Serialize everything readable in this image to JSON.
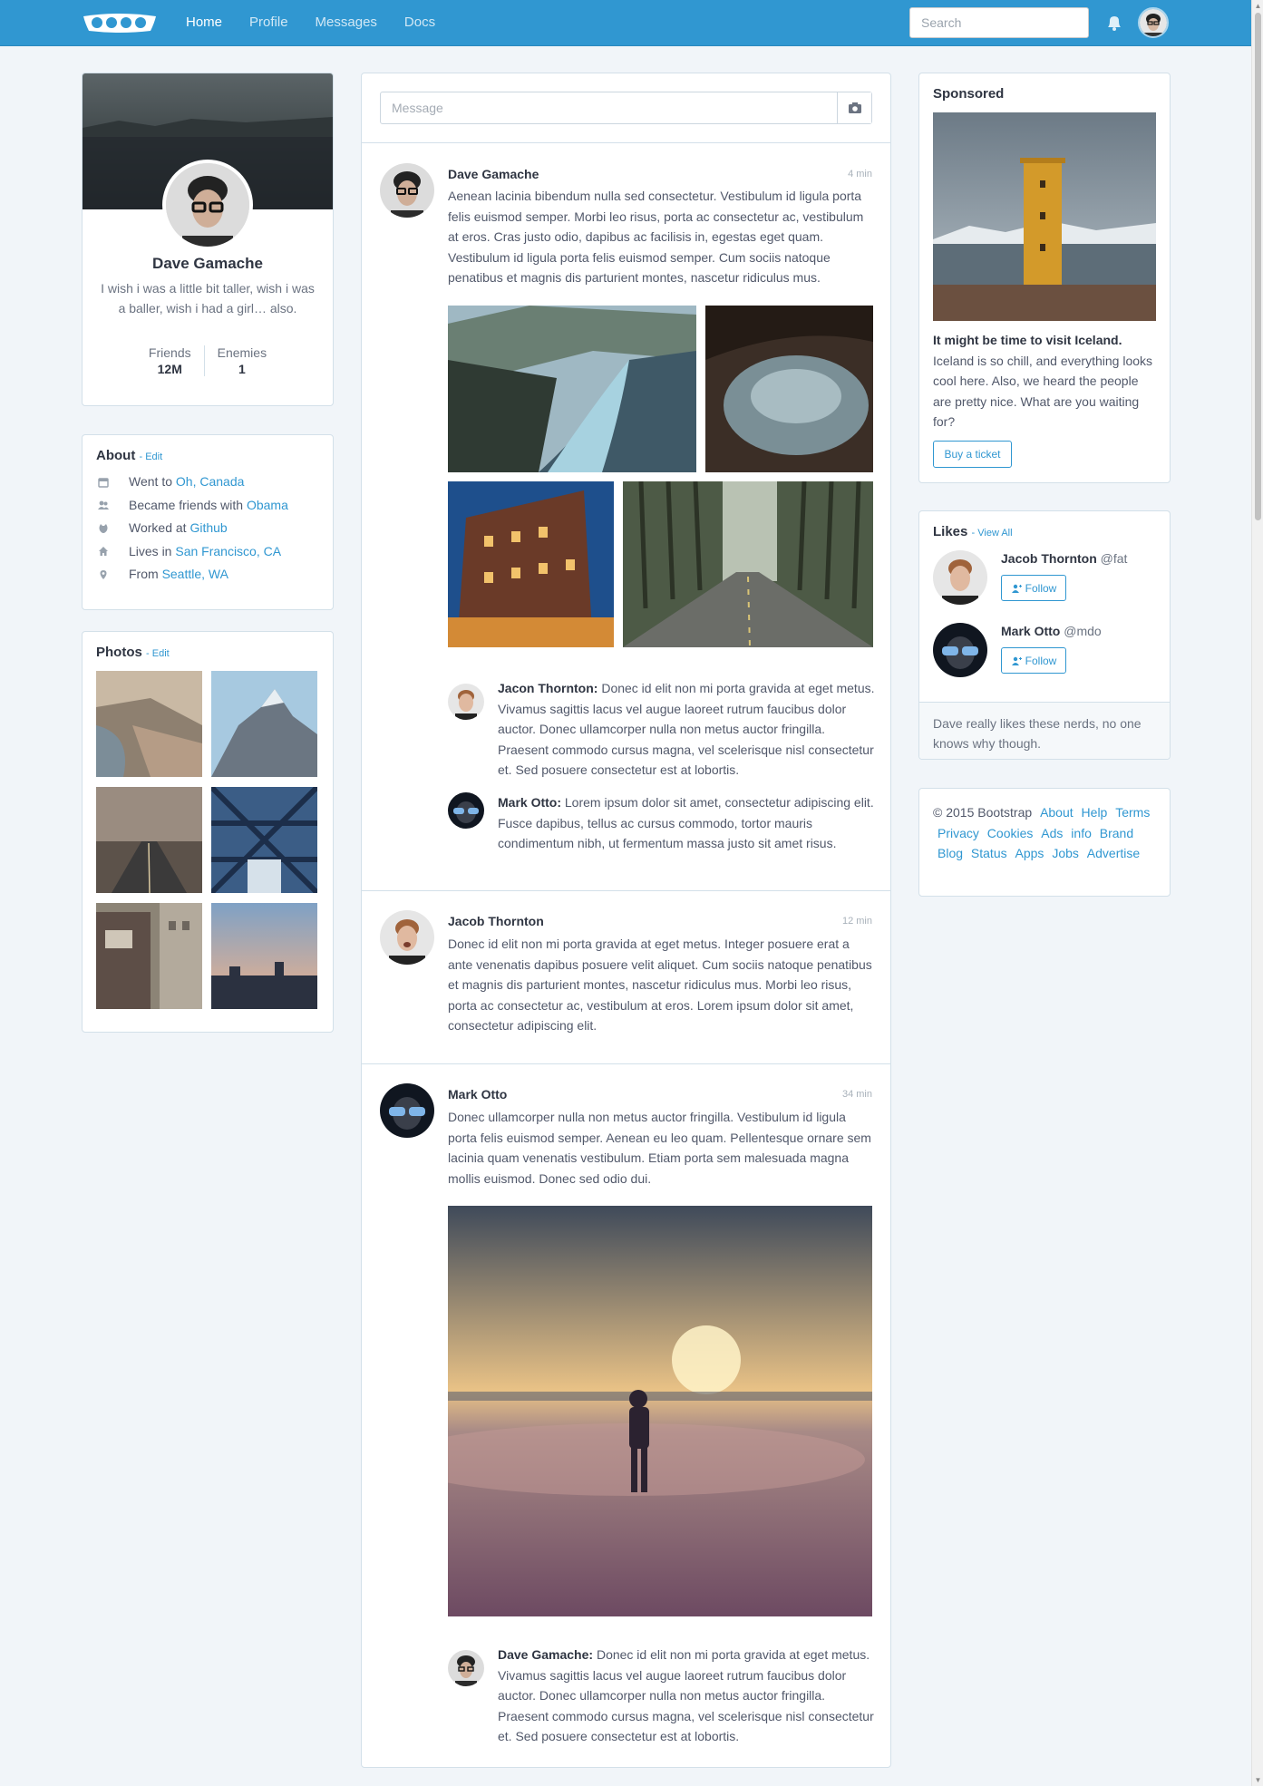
{
  "nav": {
    "links": [
      "Home",
      "Profile",
      "Messages",
      "Docs"
    ],
    "search_placeholder": "Search"
  },
  "profile": {
    "name": "Dave Gamache",
    "bio": "I wish i was a little bit taller, wish i was a baller, wish i had a girl… also.",
    "friends_label": "Friends",
    "friends_value": "12M",
    "enemies_label": "Enemies",
    "enemies_value": "1"
  },
  "about": {
    "title": "About",
    "edit": "- Edit",
    "items": [
      {
        "prefix": "Went to",
        "link": "Oh, Canada",
        "icon": "calendar-icon"
      },
      {
        "prefix": "Became friends with",
        "link": "Obama",
        "icon": "users-icon"
      },
      {
        "prefix": "Worked at",
        "link": "Github",
        "icon": "github-icon"
      },
      {
        "prefix": "Lives in",
        "link": "San Francisco, CA",
        "icon": "home-icon"
      },
      {
        "prefix": "From",
        "link": "Seattle, WA",
        "icon": "location-icon"
      }
    ]
  },
  "photos": {
    "title": "Photos",
    "edit": "- Edit"
  },
  "composer": {
    "placeholder": "Message"
  },
  "posts": [
    {
      "name": "Dave Gamache",
      "time": "4 min",
      "text": "Aenean lacinia bibendum nulla sed consectetur. Vestibulum id ligula porta felis euismod semper. Morbi leo risus, porta ac consectetur ac, vestibulum at eros. Cras justo odio, dapibus ac facilisis in, egestas eget quam. Vestibulum id ligula porta felis euismod semper. Cum sociis natoque penatibus et magnis dis parturient montes, nascetur ridiculus mus.",
      "comments": [
        {
          "name": "Jacon Thornton:",
          "text": "Donec id elit non mi porta gravida at eget metus. Vivamus sagittis lacus vel augue laoreet rutrum faucibus dolor auctor. Donec ullamcorper nulla non metus auctor fringilla. Praesent commodo cursus magna, vel scelerisque nisl consectetur et. Sed posuere consectetur est at lobortis."
        },
        {
          "name": "Mark Otto:",
          "text": "Lorem ipsum dolor sit amet, consectetur adipiscing elit. Fusce dapibus, tellus ac cursus commodo, tortor mauris condimentum nibh, ut fermentum massa justo sit amet risus."
        }
      ]
    },
    {
      "name": "Jacob Thornton",
      "time": "12 min",
      "text": "Donec id elit non mi porta gravida at eget metus. Integer posuere erat a ante venenatis dapibus posuere velit aliquet. Cum sociis natoque penatibus et magnis dis parturient montes, nascetur ridiculus mus. Morbi leo risus, porta ac consectetur ac, vestibulum at eros. Lorem ipsum dolor sit amet, consectetur adipiscing elit."
    },
    {
      "name": "Mark Otto",
      "time": "34 min",
      "text": "Donec ullamcorper nulla non metus auctor fringilla. Vestibulum id ligula porta felis euismod semper. Aenean eu leo quam. Pellentesque ornare sem lacinia quam venenatis vestibulum. Etiam porta sem malesuada magna mollis euismod. Donec sed odio dui.",
      "comments": [
        {
          "name": "Dave Gamache:",
          "text": "Donec id elit non mi porta gravida at eget metus. Vivamus sagittis lacus vel augue laoreet rutrum faucibus dolor auctor. Donec ullamcorper nulla non metus auctor fringilla. Praesent commodo cursus magna, vel scelerisque nisl consectetur et. Sed posuere consectetur est at lobortis."
        }
      ]
    }
  ],
  "sponsored": {
    "title": "Sponsored",
    "headline": "It might be time to visit Iceland.",
    "text": "Iceland is so chill, and everything looks cool here. Also, we heard the people are pretty nice. What are you waiting for?",
    "button": "Buy a ticket"
  },
  "likes": {
    "title": "Likes",
    "view_all": "- View All",
    "people": [
      {
        "name": "Jacob Thornton",
        "handle": "@fat",
        "button": "Follow"
      },
      {
        "name": "Mark Otto",
        "handle": "@mdo",
        "button": "Follow"
      }
    ],
    "footer": "Dave really likes these nerds, no one knows why though."
  },
  "footer": {
    "copyright": "© 2015 Bootstrap",
    "links": [
      "About",
      "Help",
      "Terms",
      "Privacy",
      "Cookies",
      "Ads",
      "info",
      "Brand",
      "Blog",
      "Status",
      "Apps",
      "Jobs",
      "Advertise"
    ]
  },
  "colors": {
    "brand": "#3097d1",
    "background": "#f1f5f9",
    "border": "#d3e0e9",
    "heading": "#2f3542"
  }
}
